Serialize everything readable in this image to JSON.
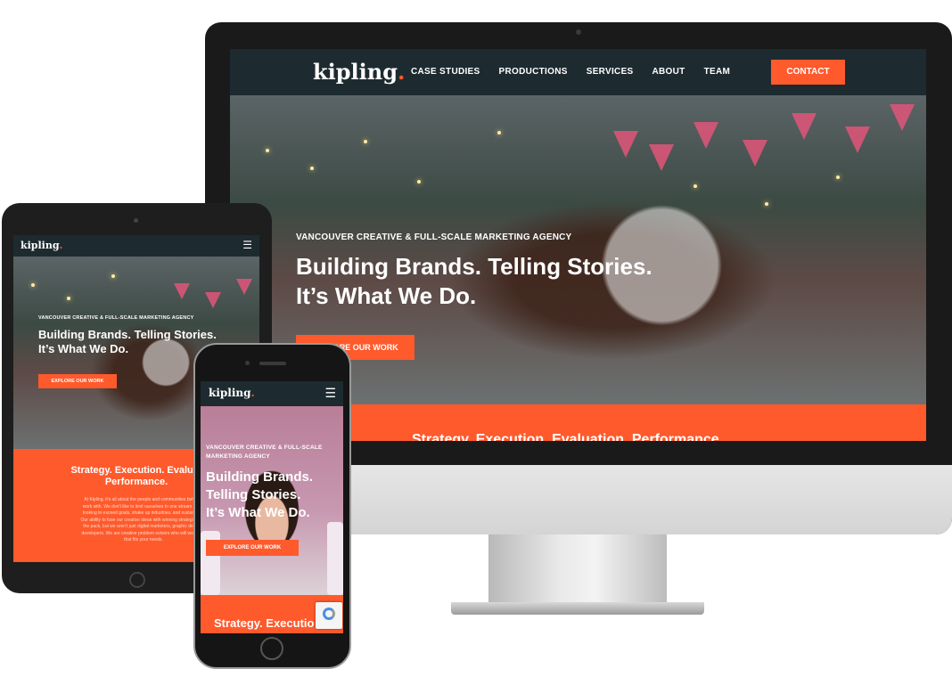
{
  "site": {
    "brand": "kipling",
    "brand_dot": ".",
    "nav": [
      "CASE STUDIES",
      "PRODUCTIONS",
      "SERVICES",
      "ABOUT",
      "TEAM"
    ],
    "contact_label": "CONTACT",
    "eyebrow": "VANCOUVER CREATIVE & FULL-SCALE MARKETING AGENCY",
    "eyebrow_line1": "VANCOUVER CREATIVE & FULL-SCALE",
    "eyebrow_line2": "MARKETING AGENCY",
    "headline_line1": "Building Brands. Telling Stories.",
    "headline_line2": "It’s What We Do.",
    "phone_headline": [
      "Building Brands.",
      "Telling Stories.",
      "It’s What We Do."
    ],
    "cta_label": "EXPLORE OUR WORK",
    "band_title": "Strategy. Execution. Evaluation. Performance.",
    "tablet_band_title_line1": "Strategy. Execution. Evaluat",
    "tablet_band_title_line2": "Performance.",
    "phone_band_title": "Strategy. Executio",
    "band_body": [
      "At Kipling, it's all about the people and communities behind t",
      "work with. We don't like to limit ourselves to one stream of ma",
      "looking to exceed goals, shake up industries, and sustain that",
      "Our ability to fuse our creative ideas with winning strategies sep",
      "the pack, but we aren't just digital marketers, graphic designe",
      "developers. We are creative problem solvers who will work to c",
      "that fits your needs."
    ],
    "hamburger": "☰"
  },
  "device_logo": ""
}
